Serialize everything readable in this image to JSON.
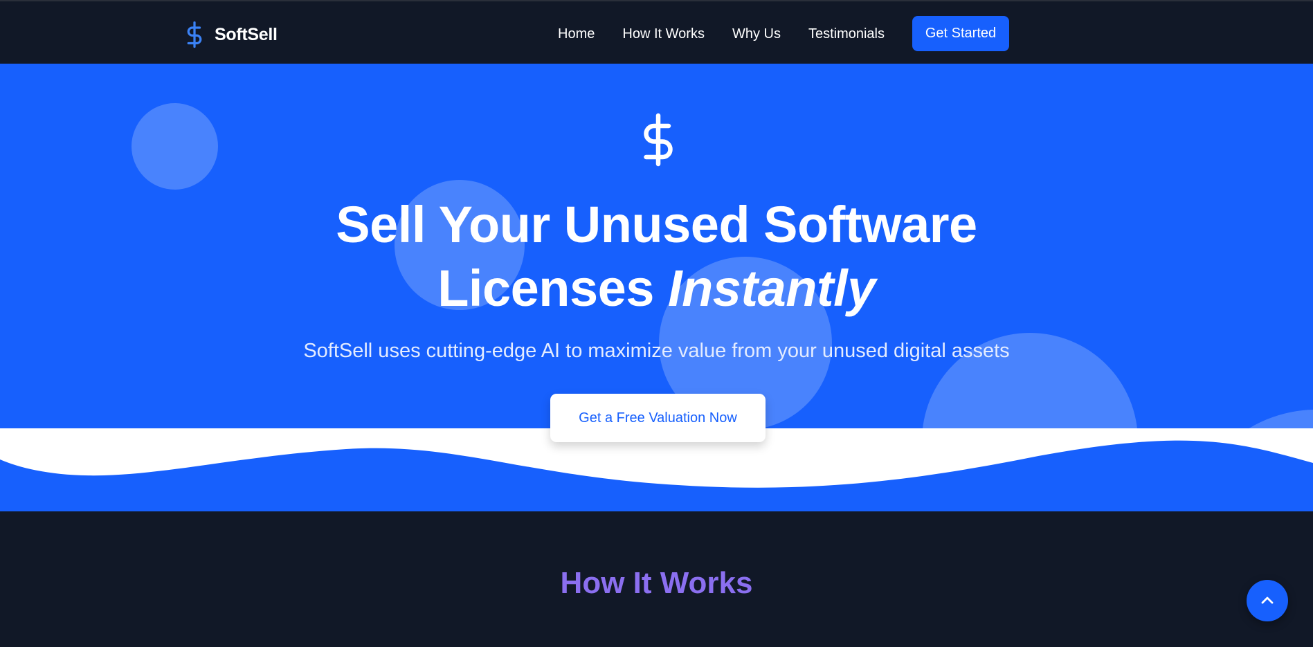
{
  "brand": {
    "name": "SoftSell",
    "icon": "dollar-sign-icon"
  },
  "nav": {
    "links": [
      "Home",
      "How It Works",
      "Why Us",
      "Testimonials"
    ],
    "cta": "Get Started"
  },
  "hero": {
    "icon": "dollar-sign-icon",
    "title_line1": "Sell Your Unused Software",
    "title_line2_plain": "Licenses",
    "title_line2_emphasis": "Instantly",
    "subtitle": "SoftSell uses cutting-edge AI to maximize value from your unused digital assets",
    "cta": "Get a Free Valuation Now"
  },
  "how_it_works": {
    "title": "How It Works"
  },
  "scroll_top": {
    "icon": "chevron-up-icon"
  },
  "colors": {
    "navbar_bg": "#111827",
    "primary": "#1760fd",
    "section_heading": "#8b6ff0",
    "white": "#ffffff"
  }
}
